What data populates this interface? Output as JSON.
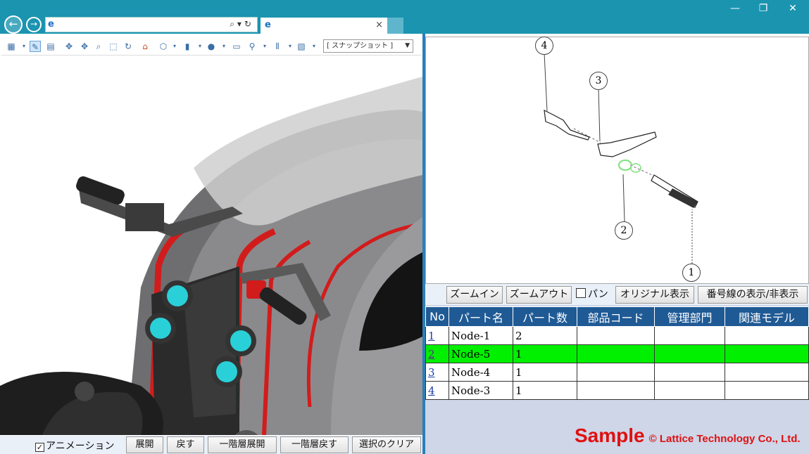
{
  "browser": {
    "address_value": "",
    "tab_title": "",
    "close_tab": "×",
    "back": "←",
    "forward": "→",
    "window": {
      "minimize": "—",
      "maximize": "❐",
      "close": "✕"
    }
  },
  "viewer": {
    "snapshot_select": "[ スナップショット ]",
    "footer": {
      "animation_label": "アニメーション",
      "animation_checked": true,
      "expand": "展開",
      "restore": "戻す",
      "expand_one_level": "一階層展開",
      "restore_one_level": "一階層戻す",
      "clear_selection": "選択のクリア"
    }
  },
  "drawing": {
    "balloons": [
      "4",
      "3",
      "2",
      "1"
    ],
    "buttons": {
      "zoom_in": "ズームイン",
      "zoom_out": "ズームアウト",
      "pan": "パン",
      "original_view": "オリジナル表示",
      "toggle_numbers": "番号線の表示/非表示"
    }
  },
  "parts_table": {
    "columns": [
      "No",
      "パート名",
      "パート数",
      "部品コード",
      "管理部門",
      "関連モデル"
    ],
    "rows": [
      {
        "no": "1",
        "name": "Node-1",
        "count": "2",
        "code": "",
        "dept": "",
        "model": ""
      },
      {
        "no": "2",
        "name": "Node-5",
        "count": "1",
        "code": "",
        "dept": "",
        "model": ""
      },
      {
        "no": "3",
        "name": "Node-4",
        "count": "1",
        "code": "",
        "dept": "",
        "model": ""
      },
      {
        "no": "4",
        "name": "Node-3",
        "count": "1",
        "code": "",
        "dept": "",
        "model": ""
      }
    ],
    "selected_row": 1,
    "selected_color": "#00f000"
  },
  "watermark": {
    "main": "Sample",
    "copyright": "© Lattice Technology Co., Ltd."
  },
  "colors": {
    "titlebar": "#1b94b0",
    "header": "#1f5a95",
    "panel": "#ced6e8"
  }
}
